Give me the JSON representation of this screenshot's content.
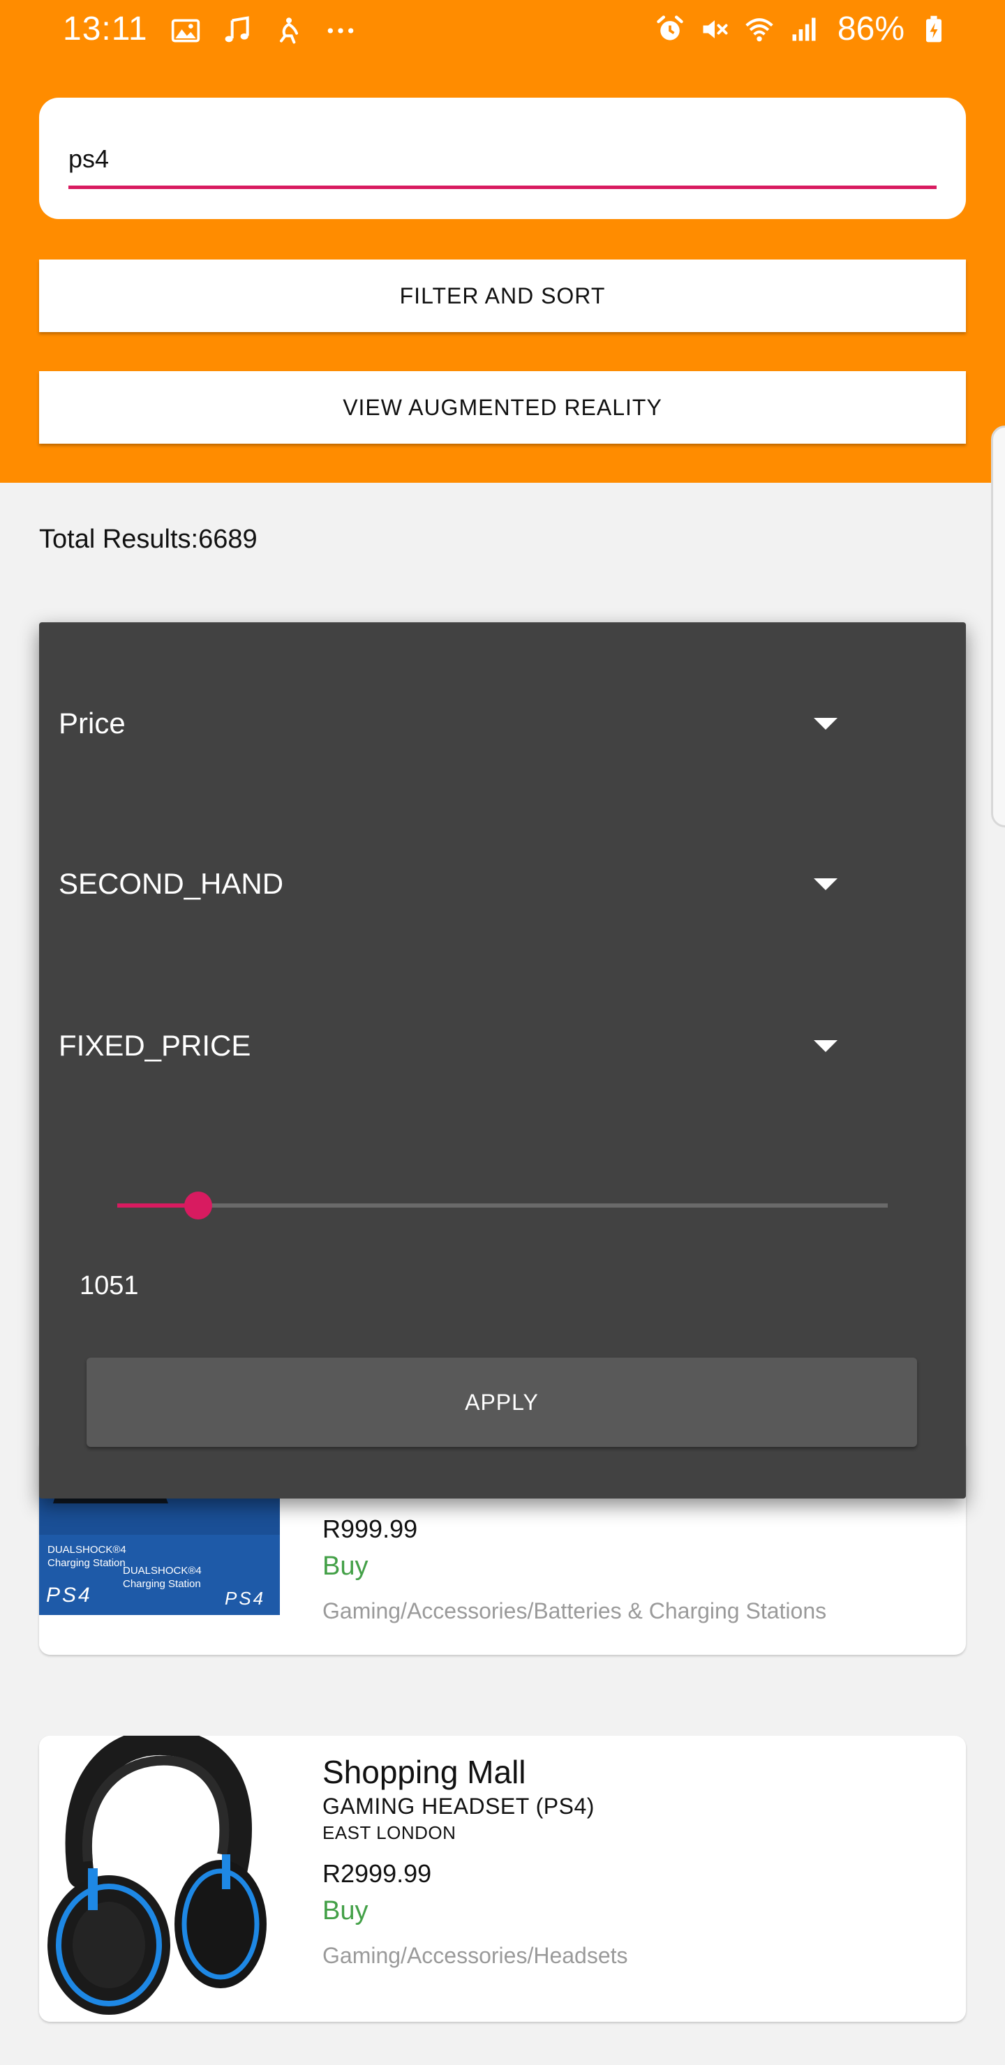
{
  "status_bar": {
    "time": "13:11",
    "battery": "86%",
    "left_icons": [
      "image-icon",
      "music-icon",
      "accessibility-icon",
      "more-dots-icon"
    ],
    "right_icons": [
      "alarm-icon",
      "mute-icon",
      "wifi-icon",
      "signal-icon",
      "battery-charging-icon"
    ]
  },
  "search": {
    "value": "ps4"
  },
  "actions": {
    "filter_sort": "FILTER AND SORT",
    "augmented_reality": "VIEW AUGMENTED REALITY"
  },
  "colors": {
    "header": "#ff8c00",
    "accent": "#d81b60",
    "dialog": "#424242",
    "buy": "#43a047"
  },
  "total_results": "Total Results:6689",
  "filter_dialog": {
    "sort_by": "Price",
    "condition": "SECOND_HAND",
    "listing_type": "FIXED_PRICE",
    "slider_fraction": 0.105,
    "slider_value": "1051",
    "apply_label": "APPLY"
  },
  "products": [
    {
      "price": "R999.99",
      "buy_label": "Buy",
      "category": "Gaming/Accessories/Batteries & Charging Stations",
      "image_texts": [
        "DUALSHOCK®4",
        "Charging Station",
        "DUALSHOCK®4",
        "Charging Station",
        "PS4",
        "PS4"
      ]
    },
    {
      "store": "Shopping Mall",
      "title": "GAMING HEADSET (PS4)",
      "location": "EAST LONDON",
      "price": "R2999.99",
      "buy_label": "Buy",
      "category": "Gaming/Accessories/Headsets"
    }
  ]
}
